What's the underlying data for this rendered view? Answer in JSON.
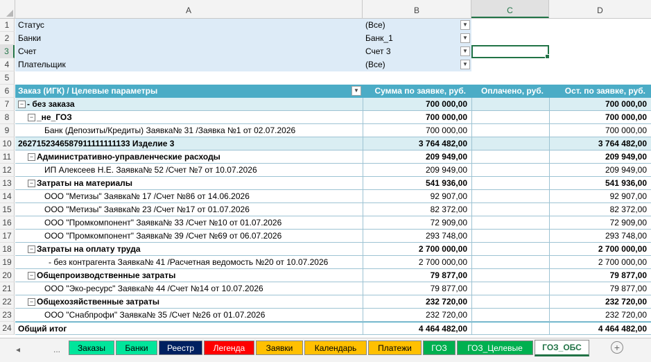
{
  "columns": [
    "A",
    "B",
    "C",
    "D"
  ],
  "filters": [
    {
      "row": "1",
      "label": "Статус",
      "value": "(Все)",
      "icon": "chevron-down-icon"
    },
    {
      "row": "2",
      "label": "Банки",
      "value": "Банк_1",
      "icon": "filter-icon"
    },
    {
      "row": "3",
      "label": "Счет",
      "value": "Счет 3",
      "icon": "filter-icon"
    },
    {
      "row": "4",
      "label": "Плательщик",
      "value": "(Все)",
      "icon": "chevron-down-icon"
    }
  ],
  "empty_row": "5",
  "header": {
    "row": "6",
    "col_a": "Заказ (ИГК) / Целевые параметры",
    "col_b": "Сумма по заявке, руб.",
    "col_c": "Оплачено, руб.",
    "col_d": "Ост. по заявке, руб."
  },
  "rows": [
    {
      "row": "7",
      "text": "- без заказа",
      "b": "700 000,00",
      "c": "",
      "d": "700 000,00"
    },
    {
      "row": "8",
      "text": "_не_ГОЗ",
      "b": "700 000,00",
      "c": "",
      "d": "700 000,00"
    },
    {
      "row": "9",
      "text": "Банк (Депозиты/Кредиты) Заявка№ 31 /Заявка №1 от 02.07.2026",
      "b": "700 000,00",
      "c": "",
      "d": "700 000,00"
    },
    {
      "row": "10",
      "text": "2627152346587911111111133 Изделие 3",
      "b": "3 764 482,00",
      "c": "",
      "d": "3 764 482,00"
    },
    {
      "row": "11",
      "text": "Административно-управленческие расходы",
      "b": "209 949,00",
      "c": "",
      "d": "209 949,00"
    },
    {
      "row": "12",
      "text": "ИП Алексеев Н.Е. Заявка№ 52 /Счет №7 от 10.07.2026",
      "b": "209 949,00",
      "c": "",
      "d": "209 949,00"
    },
    {
      "row": "13",
      "text": "Затраты на материалы",
      "b": "541 936,00",
      "c": "",
      "d": "541 936,00"
    },
    {
      "row": "14",
      "text": "ООО \"Метизы\" Заявка№ 17 /Счет №86 от 14.06.2026",
      "b": "92 907,00",
      "c": "",
      "d": "92 907,00"
    },
    {
      "row": "15",
      "text": "ООО \"Метизы\" Заявка№ 23 /Счет №17 от 01.07.2026",
      "b": "82 372,00",
      "c": "",
      "d": "82 372,00"
    },
    {
      "row": "16",
      "text": "ООО \"Промкомпонент\" Заявка№ 33 /Счет №10 от 01.07.2026",
      "b": "72 909,00",
      "c": "",
      "d": "72 909,00"
    },
    {
      "row": "17",
      "text": "ООО \"Промкомпонент\" Заявка№ 39 /Счет №69 от 06.07.2026",
      "b": "293 748,00",
      "c": "",
      "d": "293 748,00"
    },
    {
      "row": "18",
      "text": "Затраты на оплату труда",
      "b": "2 700 000,00",
      "c": "",
      "d": "2 700 000,00"
    },
    {
      "row": "19",
      "text": "- без контрагента Заявка№ 41 /Расчетная ведомость №20 от 10.07.2026",
      "b": "2 700 000,00",
      "c": "",
      "d": "2 700 000,00"
    },
    {
      "row": "20",
      "text": "Общепроизводственные затраты",
      "b": "79 877,00",
      "c": "",
      "d": "79 877,00"
    },
    {
      "row": "21",
      "text": "ООО \"Эко-ресурс\" Заявка№ 44 /Счет №14 от 10.07.2026",
      "b": "79 877,00",
      "c": "",
      "d": "79 877,00"
    },
    {
      "row": "22",
      "text": "Общехозяйственные затраты",
      "b": "232 720,00",
      "c": "",
      "d": "232 720,00"
    },
    {
      "row": "23",
      "text": "ООО \"Снабпрофи\" Заявка№ 35 /Счет №26 от 01.07.2026",
      "b": "232 720,00",
      "c": "",
      "d": "232 720,00"
    },
    {
      "row": "24",
      "text": "Общий итог",
      "b": "4 464 482,00",
      "c": "",
      "d": "4 464 482,00"
    }
  ],
  "tabs": {
    "nav_prev": "◂",
    "nav_more": "...",
    "items": [
      {
        "label": "Заказы",
        "bg": "#00e59b",
        "fg": "#000000"
      },
      {
        "label": "Банки",
        "bg": "#00e59b",
        "fg": "#000000"
      },
      {
        "label": "Реестр",
        "bg": "#002060",
        "fg": "#ffffff"
      },
      {
        "label": "Легенда",
        "bg": "#ff0000",
        "fg": "#ffffff"
      },
      {
        "label": "Заявки",
        "bg": "#ffc000",
        "fg": "#000000"
      },
      {
        "label": "Календарь",
        "bg": "#ffc000",
        "fg": "#000000"
      },
      {
        "label": "Платежи",
        "bg": "#ffc000",
        "fg": "#000000"
      },
      {
        "label": "ГОЗ",
        "bg": "#00b050",
        "fg": "#ffffff"
      },
      {
        "label": "ГОЗ_Целевые",
        "bg": "#00b050",
        "fg": "#ffffff"
      },
      {
        "label": "ГОЗ_ОБС",
        "bg": "#ffffff",
        "fg": "#217346",
        "active": true
      }
    ],
    "add": "+"
  },
  "colors": {
    "header_bg": "#4bacc6",
    "filter_bg": "#ddebf7",
    "group_bg": "#daeef3",
    "accent": "#217346"
  }
}
